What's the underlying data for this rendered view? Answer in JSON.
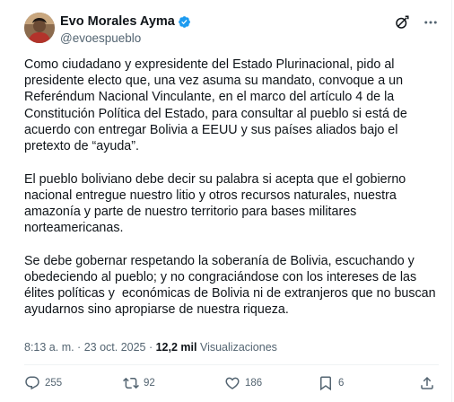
{
  "author": {
    "display_name": "Evo Morales Ayma",
    "handle": "@evoespueblo",
    "verified": true,
    "verified_color": "#1d9bf0"
  },
  "tweet": {
    "paragraphs": [
      "Como ciudadano y expresidente del Estado Plurinacional, pido al presidente electo que, una vez asuma su mandato, convoque a un Referéndum Nacional Vinculante, en el marco del artículo 4 de la Constitución Política del Estado, para consultar al pueblo si está de acuerdo con entregar Bolivia a EEUU y sus países aliados bajo el pretexto de “ayuda”.",
      "El pueblo boliviano debe decir su palabra si acepta que el gobierno nacional entregue nuestro litio y otros recursos naturales, nuestra amazonía y parte de nuestro territorio para bases militares norteamericanas.",
      "Se debe gobernar respetando la soberanía de Bolivia, escuchando y obedeciendo al pueblo; y no congraciándose con los intereses de las élites políticas y  económicas de Bolivia ni de extranjeros que no buscan ayudarnos sino apropiarse de nuestra riqueza."
    ],
    "timestamp": "8:13 a. m. · 23 oct. 2025",
    "separator": " · ",
    "views_count": "12,2 mil",
    "views_label": "Visualizaciones"
  },
  "actions": {
    "replies": "255",
    "reposts": "92",
    "likes": "186",
    "bookmarks": "6"
  },
  "icons": {
    "header": [
      "grok-icon",
      "more-icon"
    ],
    "actions": [
      "reply-icon",
      "repost-icon",
      "like-icon",
      "views-icon",
      "share-icon"
    ]
  },
  "colors": {
    "text": "#0f1419",
    "secondary": "#536471",
    "accent": "#1d9bf0"
  }
}
